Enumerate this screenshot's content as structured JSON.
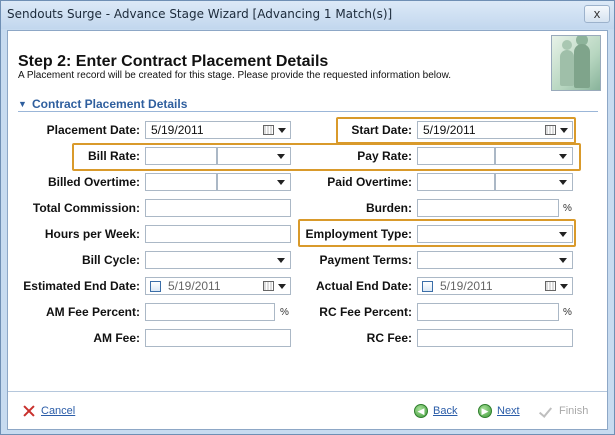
{
  "window": {
    "title": "Sendouts Surge - Advance Stage Wizard [Advancing 1 Match(s)]",
    "close_glyph": "x"
  },
  "header": {
    "title": "Step 2: Enter Contract Placement Details",
    "subtitle": "A Placement record will be created for this stage. Please provide the requested information below."
  },
  "section": {
    "label": "Contract Placement Details",
    "arrow": "▼"
  },
  "fields": {
    "placement_date": {
      "label": "Placement Date:",
      "value": "5/19/2011"
    },
    "start_date": {
      "label": "Start Date:",
      "value": "5/19/2011"
    },
    "bill_rate": {
      "label": "Bill Rate:",
      "value": ""
    },
    "pay_rate": {
      "label": "Pay Rate:",
      "value": ""
    },
    "billed_overtime": {
      "label": "Billed Overtime:",
      "value": ""
    },
    "paid_overtime": {
      "label": "Paid Overtime:",
      "value": ""
    },
    "total_commission": {
      "label": "Total Commission:",
      "value": ""
    },
    "burden": {
      "label": "Burden:",
      "value": "",
      "suffix": "%"
    },
    "hours_per_week": {
      "label": "Hours per Week:",
      "value": ""
    },
    "employment_type": {
      "label": "Employment Type:",
      "value": ""
    },
    "bill_cycle": {
      "label": "Bill Cycle:",
      "value": ""
    },
    "payment_terms": {
      "label": "Payment Terms:",
      "value": ""
    },
    "estimated_end_date": {
      "label": "Estimated End Date:",
      "value": "5/19/2011"
    },
    "actual_end_date": {
      "label": "Actual End Date:",
      "value": "5/19/2011"
    },
    "am_fee_percent": {
      "label": "AM Fee Percent:",
      "value": "",
      "suffix": "%"
    },
    "rc_fee_percent": {
      "label": "RC Fee Percent:",
      "value": "",
      "suffix": "%"
    },
    "am_fee": {
      "label": "AM Fee:",
      "value": ""
    },
    "rc_fee": {
      "label": "RC Fee:",
      "value": ""
    }
  },
  "footer": {
    "cancel": "Cancel",
    "back": "Back",
    "next": "Next",
    "finish": "Finish"
  },
  "colors": {
    "highlight": "#d99a2b",
    "link": "#2a5ca8",
    "section": "#2f5f9e"
  },
  "icons": [
    "close-icon",
    "cancel-x-icon",
    "back-arrow-icon",
    "next-arrow-icon",
    "finish-check-icon",
    "calendar-icon",
    "chevron-down-icon",
    "people-image"
  ]
}
